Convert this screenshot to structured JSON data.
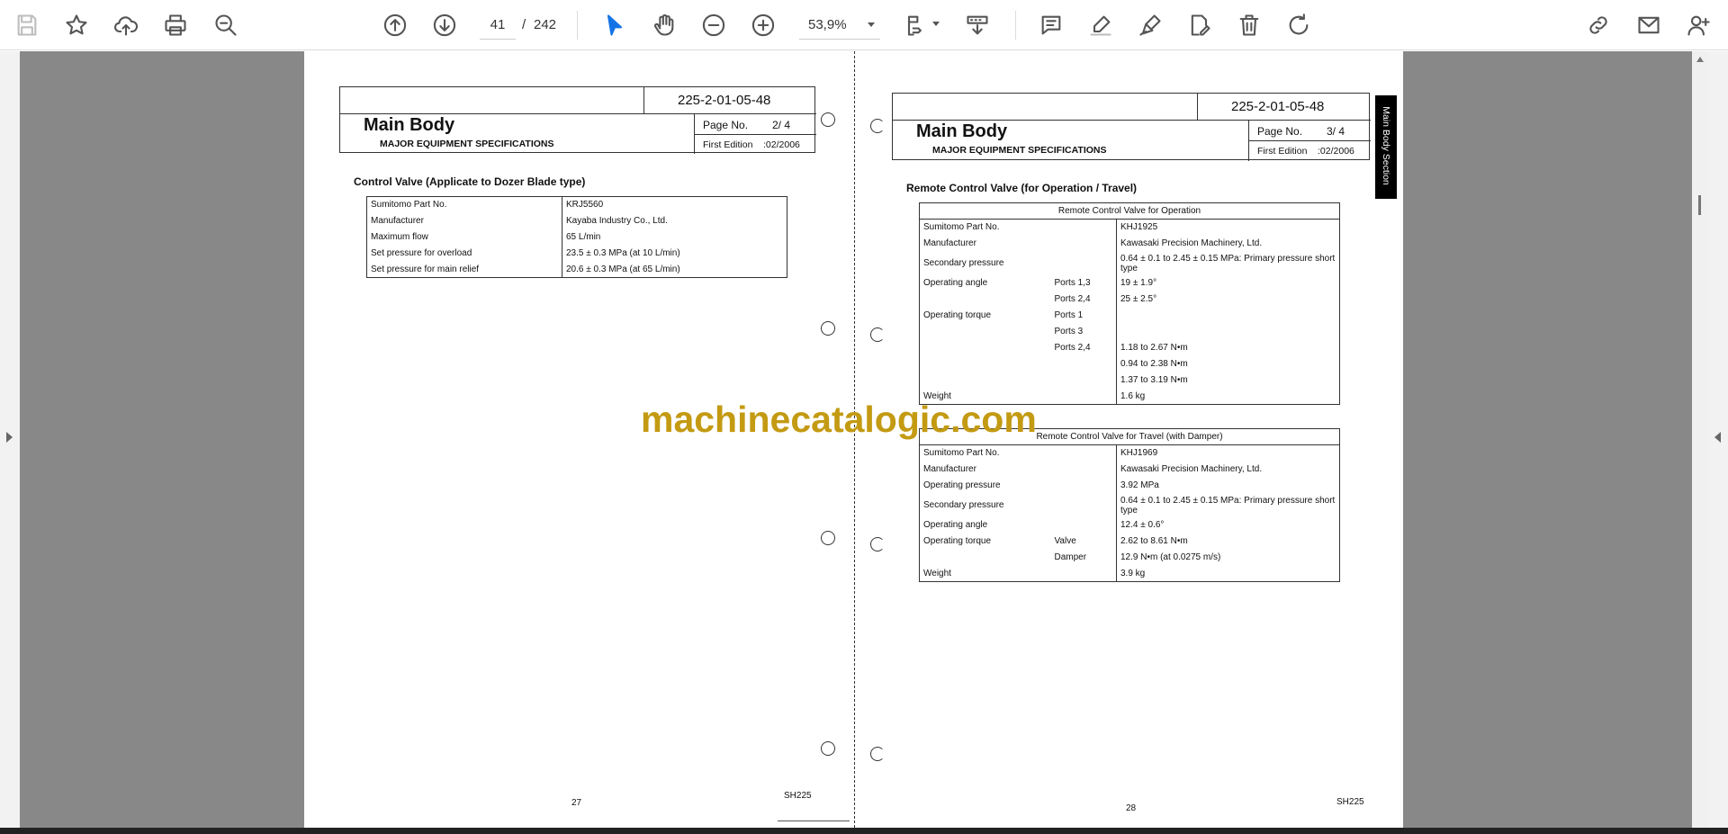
{
  "toolbar": {
    "current_page": "41",
    "page_separator": "/",
    "total_pages": "242",
    "zoom": "53,9%"
  },
  "icons": [
    "save-icon",
    "bookmark-star-icon",
    "upload-cloud-icon",
    "print-icon",
    "find-zoom-icon",
    "previous-page-icon",
    "next-page-icon",
    "select-cursor-icon",
    "hand-tool-icon",
    "zoom-out-icon",
    "zoom-in-icon",
    "page-fit-icon",
    "scroll-mode-icon",
    "comment-icon",
    "highlight-icon",
    "sign-icon",
    "fill-sign-icon",
    "delete-icon",
    "rotate-icon",
    "share-link-icon",
    "email-icon",
    "account-icon"
  ],
  "left_page": {
    "doc_number": "225-2-01-05-48",
    "title": "Main Body",
    "subtitle": "MAJOR EQUIPMENT SPECIFICATIONS",
    "page_label": "Page No.",
    "page_value": "2/  4",
    "edition_label": "First Edition",
    "edition_value": ":02/2006",
    "section_title": "Control Valve (Applicate to Dozer Blade type)",
    "rows": [
      {
        "label": "Sumitomo Part No.",
        "value": "KRJ5560"
      },
      {
        "label": "Manufacturer",
        "value": "Kayaba Industry Co., Ltd."
      },
      {
        "label": "Maximum flow",
        "value": "65 L/min"
      },
      {
        "label": "Set pressure for overload",
        "value": "23.5 ± 0.3 MPa (at 10 L/min)"
      },
      {
        "label": "Set pressure for main relief",
        "value": "20.6 ± 0.3 MPa (at 65 L/min)"
      }
    ],
    "page_number": "27",
    "model": "SH225"
  },
  "right_page": {
    "doc_number": "225-2-01-05-48",
    "title": "Main Body",
    "subtitle": "MAJOR EQUIPMENT SPECIFICATIONS",
    "page_label": "Page No.",
    "page_value": "3/  4",
    "edition_label": "First Edition",
    "edition_value": ":02/2006",
    "side_label": "Main Body Section",
    "section_title": "Remote Control Valve (for Operation / Travel)",
    "table1": {
      "caption": "Remote Control Valve for Operation",
      "rows": [
        {
          "label": "Sumitomo Part No.",
          "sub": "",
          "value": "KHJ1925"
        },
        {
          "label": "Manufacturer",
          "sub": "",
          "value": "Kawasaki Precision Machinery, Ltd."
        },
        {
          "label": "Secondary pressure",
          "sub": "",
          "value": "0.64 ± 0.1 to 2.45 ± 0.15 MPa: Primary pressure short type"
        },
        {
          "label": "Operating angle",
          "sub": "Ports 1,3",
          "value": "19 ± 1.9°"
        },
        {
          "label": "",
          "sub": "Ports 2,4",
          "value": "25 ± 2.5°"
        },
        {
          "label": "Operating torque",
          "sub": "Ports 1",
          "value": ""
        },
        {
          "label": "",
          "sub": "Ports 3",
          "value": ""
        },
        {
          "label": "",
          "sub": "Ports 2,4",
          "value": "1.18 to 2.67 N•m"
        },
        {
          "label": "",
          "sub": "",
          "value": "0.94 to 2.38 N•m"
        },
        {
          "label": "",
          "sub": "",
          "value": "1.37 to 3.19 N•m"
        },
        {
          "label": "Weight",
          "sub": "",
          "value": "1.6 kg"
        }
      ]
    },
    "table2": {
      "caption": "Remote Control Valve for Travel (with Damper)",
      "rows": [
        {
          "label": "Sumitomo Part No.",
          "sub": "",
          "value": "KHJ1969"
        },
        {
          "label": "Manufacturer",
          "sub": "",
          "value": "Kawasaki Precision Machinery, Ltd."
        },
        {
          "label": "Operating pressure",
          "sub": "",
          "value": "3.92 MPa"
        },
        {
          "label": "Secondary pressure",
          "sub": "",
          "value": "0.64 ± 0.1 to 2.45 ± 0.15 MPa: Primary pressure short type"
        },
        {
          "label": "Operating angle",
          "sub": "",
          "value": "12.4 ± 0.6°"
        },
        {
          "label": "Operating torque",
          "sub": "Valve",
          "value": "2.62 to 8.61 N•m"
        },
        {
          "label": "",
          "sub": "Damper",
          "value": "12.9 N•m (at 0.0275 m/s)"
        },
        {
          "label": "Weight",
          "sub": "",
          "value": "3.9 kg"
        }
      ]
    },
    "page_number": "28",
    "model": "SH225"
  },
  "watermark": "machinecatalogic.com"
}
